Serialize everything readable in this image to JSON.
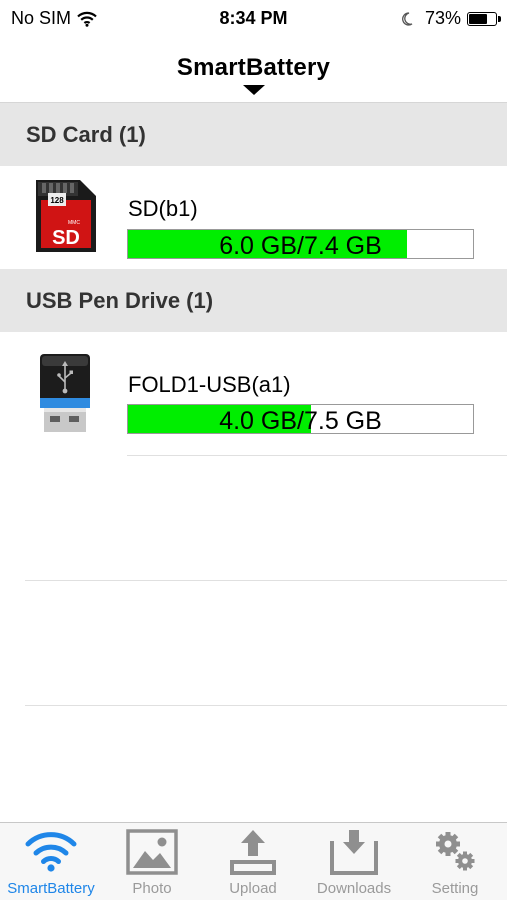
{
  "status_bar": {
    "carrier": "No SIM",
    "time": "8:34 PM",
    "battery_percent": "73%",
    "battery_level": 0.73
  },
  "nav": {
    "title": "SmartBattery"
  },
  "sections": [
    {
      "header": "SD Card (1)",
      "devices": [
        {
          "name": "SD(b1)",
          "usage": "6.0 GB/7.4 GB",
          "used_fraction": 0.81,
          "icon": "sd-card-icon",
          "chip_label": "128",
          "chip_brand": "MMC",
          "chip_text": "SD"
        }
      ]
    },
    {
      "header": "USB Pen Drive (1)",
      "devices": [
        {
          "name": "FOLD1-USB(a1)",
          "usage": "4.0 GB/7.5 GB",
          "used_fraction": 0.53,
          "icon": "usb-drive-icon"
        }
      ]
    }
  ],
  "tabs": [
    {
      "label": "SmartBattery",
      "icon": "wifi-icon",
      "active": true
    },
    {
      "label": "Photo",
      "icon": "photo-icon",
      "active": false
    },
    {
      "label": "Upload",
      "icon": "upload-icon",
      "active": false
    },
    {
      "label": "Downloads",
      "icon": "download-icon",
      "active": false
    },
    {
      "label": "Setting",
      "icon": "gear-icon",
      "active": false
    }
  ],
  "colors": {
    "accent": "#1f86e8",
    "bar_fill": "#00ee00",
    "section_bg": "#e6e6e6",
    "tab_inactive": "#9a9a9a"
  }
}
